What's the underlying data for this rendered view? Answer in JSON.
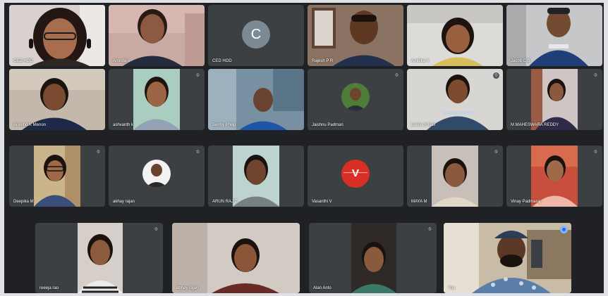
{
  "participants_row1": [
    {
      "name": "CED HOD"
    },
    {
      "name": "Amruta s"
    },
    {
      "name": "CED HOD",
      "initial": "C"
    },
    {
      "name": "Rajesh P R"
    },
    {
      "name": "Ambika V"
    },
    {
      "name": "Jacob C B"
    }
  ],
  "participants_row2": [
    {
      "name": "Aravind K Menon"
    },
    {
      "name": "ashvanth k"
    },
    {
      "name": "Benny Philip"
    },
    {
      "name": "Jaishnu Padman"
    },
    {
      "name": "Lesha S Nair"
    },
    {
      "name": "M MAHESWARA REDDY"
    }
  ],
  "participants_row3": [
    {
      "name": "Deepika M"
    },
    {
      "name": "akhay rajan"
    },
    {
      "name": "ARUN RAJ T"
    },
    {
      "name": "Vasanthi V",
      "initial": "V"
    },
    {
      "name": "MAYA M"
    },
    {
      "name": "Vinay Padmaraj"
    }
  ],
  "participants_row4": [
    {
      "name": "reeeja rao"
    },
    {
      "name": "abhay rajan"
    },
    {
      "name": "Alan Anto"
    },
    {
      "name": "You"
    }
  ],
  "colors": {
    "grid_bg": "#202124",
    "tile_bg": "#3c4043",
    "active_outline": "#8ab4f8",
    "vasanthi_avatar": "#d93025",
    "ced_avatar": "#7d8a93"
  }
}
